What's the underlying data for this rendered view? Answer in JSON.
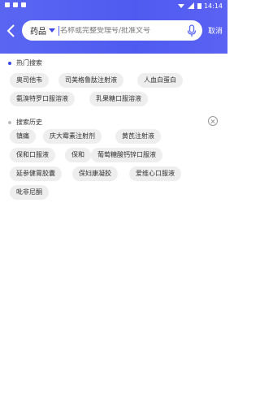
{
  "status": {
    "time": "14:14"
  },
  "search": {
    "category": "药品",
    "placeholder": "名称或完整受理号/批准文号",
    "cancel_label": "取消"
  },
  "hot": {
    "title": "热门搜索",
    "dot_color": "#3b47e6",
    "items": [
      "奥司他韦",
      "司美格鲁肽注射液",
      "人血白蛋白",
      "氨溴特罗口服溶液",
      "乳果糖口服溶液"
    ]
  },
  "history": {
    "title": "搜索历史",
    "dot_color": "#bbbbbb",
    "items": [
      "镇痛",
      "庆大霉素注射剂",
      "黄芪注射液",
      "保和口服液",
      "保和",
      "葡萄糖酸钙锌口服液",
      "延参健胃胶囊",
      "保妇康凝胶",
      "爱维心口服液",
      "吡非尼酮"
    ]
  },
  "colors": {
    "brand": "#5a66f2",
    "chip_bg": "#eeeeee"
  }
}
